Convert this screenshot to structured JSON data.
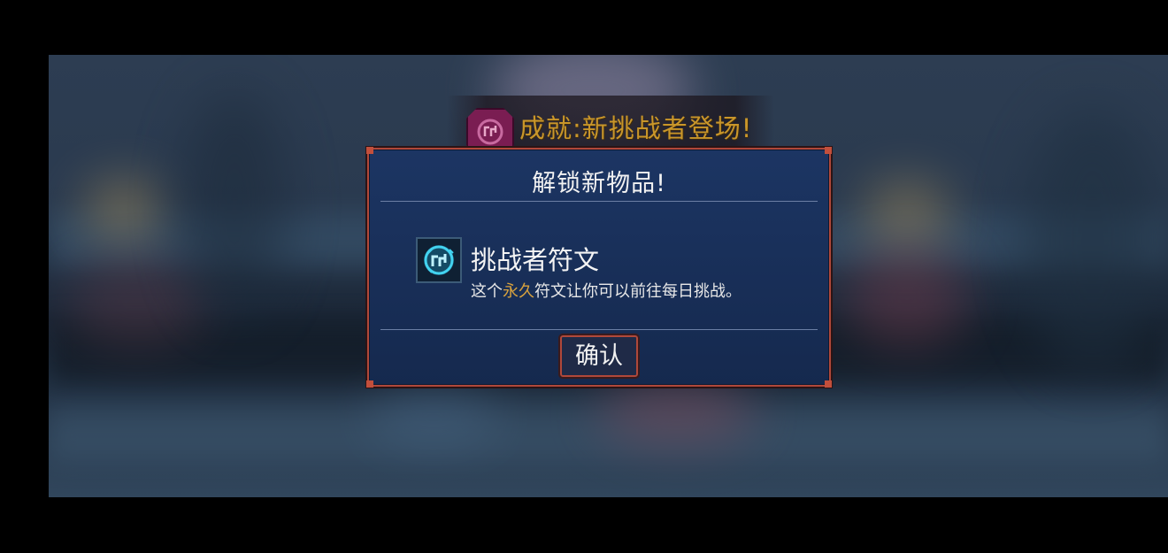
{
  "achievement": {
    "icon": "rune-icon",
    "text": "成就:新挑战者登场!",
    "color": "#c9962a"
  },
  "modal": {
    "title": "解锁新物品!",
    "item": {
      "icon": "challenger-rune-icon",
      "name": "挑战者符文",
      "desc_before": "这个",
      "desc_highlight": "永久",
      "desc_after": "符文让你可以前往每日挑战。",
      "highlight_color": "#d8a23e"
    },
    "confirm_label": "确认",
    "border_color": "#b0483a"
  }
}
